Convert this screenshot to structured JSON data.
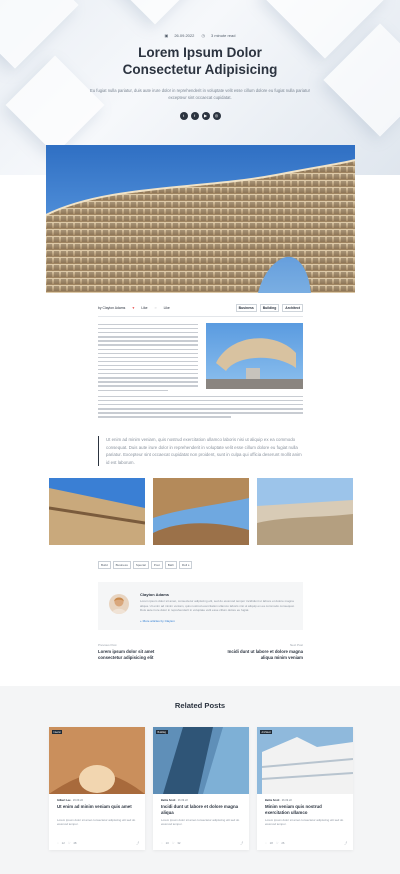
{
  "hero": {
    "date": "26.09.2022",
    "read_time": "3 minute read",
    "title_line1": "Lorem Ipsum Dolor",
    "title_line2": "Consectetur Adipisicing",
    "subtitle": "Eu fugiat nulla pariatur, duis aute irure dolor in reprehenderit in voluptate velit esse cillum dolore eu fugiat nulla pariatur excepteur sint occaecat cupidatat.",
    "social": [
      "twitter-icon",
      "facebook-icon",
      "youtube-icon",
      "instagram-icon"
    ]
  },
  "byline": {
    "author": "by Clayton Adams",
    "likes": "Like",
    "comments": "Like",
    "tags": [
      "Business",
      "Building",
      "Architect"
    ]
  },
  "quote": "Ut enim ad minim veniam, quis nostrud exercitation ullamco laboris nisi ut aliquip ex ea commodo consequat. Duis aute irure dolor in reprehenderit in voluptate velit esse cillum dolore eu fugiat nulla pariatur. Excepteur sint occaecat cupidatat non proident, sunt in culpa qui officia deserunt mollit anim id est laborum.",
  "tag_list": [
    "Build",
    "Business",
    "Special",
    "Post",
    "Bath",
    "Roll s"
  ],
  "author_box": {
    "name": "Clayton Adams",
    "bio": "Lorem ipsum dolor sit amet, consectetur adipiscing elit, sed do eiusmod tempor incididunt ut labore et dolore magna aliqua. Ut enim ad minim veniam, quis nostrud exercitation ullamco laboris nisi ut aliquip ex ea commodo consequat. Duis aute irure dolor in reprehenderit in voluptate velit esse cillum dolore eu fugiat.",
    "link": "+ More articles by Clayton"
  },
  "post_nav": {
    "prev_label": "Previous Post",
    "prev_title": "Lorem ipsum dolor sit amet consectetur adipisicing elit",
    "next_label": "Next Post",
    "next_title": "Incidi dunt ut labore et dolore magna aliqua minim veniam"
  },
  "related": {
    "heading": "Related Posts",
    "cards": [
      {
        "badge": "Interior",
        "author": "Gilbert Lee",
        "date": "26.09.22",
        "title": "Ut enim ad minim veniam quis amet",
        "excerpt": "Lorem ipsum dolor sit amet consectetur adipiscing elit sed do eiusmod tempor.",
        "likes": "12",
        "comments": "48"
      },
      {
        "badge": "Building",
        "author": "Bettie Scott",
        "date": "26.09.22",
        "title": "Incidi dunt ut labore et dolore magna aliqua",
        "excerpt": "Lorem ipsum dolor sit amet consectetur adipiscing elit sed do eiusmod tempor.",
        "likes": "10",
        "comments": "32"
      },
      {
        "badge": "Architect",
        "author": "Bettie Scott",
        "date": "26.09.22",
        "title": "Minim veniam quis nostrud exercitation ullamco",
        "excerpt": "Lorem ipsum dolor sit amet consectetur adipiscing elit sed do eiusmod tempor.",
        "likes": "18",
        "comments": "26"
      }
    ]
  },
  "colors": {
    "accent": "#2c3440",
    "like": "#e63b3b",
    "link": "#2b7bd2",
    "sky": "#3f7fcf"
  }
}
